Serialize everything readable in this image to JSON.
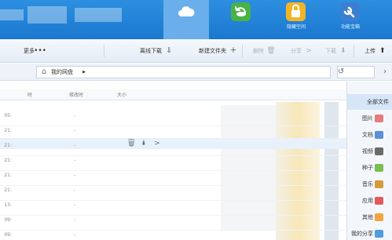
{
  "header": {
    "tiles": [
      {
        "label": "功能宝箱",
        "icon": "wrench-icon"
      },
      {
        "label": "隐藏空间",
        "icon": "lock-icon"
      },
      {
        "label": "",
        "icon": "recycle-icon"
      },
      {
        "label": "",
        "icon": "cloud-icon"
      }
    ]
  },
  "toolbar": {
    "upload": "上传",
    "download": "下载",
    "share": "分享",
    "delete": "删除",
    "new_folder": "新建文件夹",
    "offline_download": "离线下载",
    "more": "更多"
  },
  "address": {
    "path": "我的网盘",
    "separator": "▶"
  },
  "columns": {
    "size": "大小",
    "modified": "修改时",
    "header_blurred": "时"
  },
  "sidebar": {
    "items": [
      {
        "label": "全部文件",
        "icon": "folder-icon",
        "color": "#5aa1e6"
      },
      {
        "label": "图片",
        "icon": "image-icon",
        "color": "#e67d7d"
      },
      {
        "label": "文档",
        "icon": "document-icon",
        "color": "#5b8fd6"
      },
      {
        "label": "视频",
        "icon": "video-icon",
        "color": "#6a6a6a"
      },
      {
        "label": "种子",
        "icon": "bt-icon",
        "color": "#7bbd4f"
      },
      {
        "label": "音乐",
        "icon": "music-icon",
        "color": "#d59a3a"
      },
      {
        "label": "应用",
        "icon": "app-icon",
        "color": "#e25b5b"
      },
      {
        "label": "其他",
        "icon": "other-icon",
        "color": "#f0a640"
      },
      {
        "label": "我的分享",
        "icon": "share-icon",
        "color": "#4f9be0"
      }
    ]
  },
  "rows": [
    {
      "time": "05:",
      "dash": "-"
    },
    {
      "time": "21:",
      "dash": "-"
    },
    {
      "time": "21:",
      "dash": "-"
    },
    {
      "time": "21:",
      "dash": "-"
    },
    {
      "time": "21:",
      "dash": "-"
    },
    {
      "time": "21:",
      "dash": "-"
    },
    {
      "time": "13:",
      "dash": "-"
    },
    {
      "time": "09:",
      "dash": "-"
    },
    {
      "time": "09:",
      "dash": "-"
    }
  ],
  "colors": {
    "header_blue": "#1f82d6",
    "selected_row": "#d6e6f7",
    "hover_row": "#e7f1fb"
  }
}
